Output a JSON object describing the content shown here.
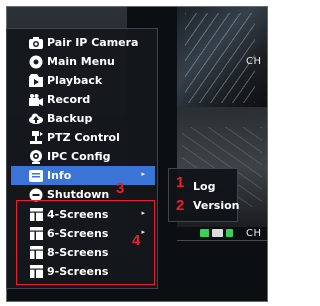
{
  "camera_labels": {
    "top": "CH",
    "bottom": "CH"
  },
  "menu": {
    "items": [
      {
        "label": "Pair IP Camera",
        "icon": "camera-icon"
      },
      {
        "label": "Main Menu",
        "icon": "gear-icon"
      },
      {
        "label": "Playback",
        "icon": "playback-icon"
      },
      {
        "label": "Record",
        "icon": "record-icon"
      },
      {
        "label": "Backup",
        "icon": "cloud-backup-icon"
      },
      {
        "label": "PTZ Control",
        "icon": "ptz-icon"
      },
      {
        "label": "IPC Config",
        "icon": "ipc-config-icon"
      },
      {
        "label": "Info",
        "icon": "info-icon",
        "selected": true,
        "has_submenu": true
      },
      {
        "label": "Shutdown",
        "icon": "power-icon"
      },
      {
        "label": "4-Screens",
        "icon": "screen-layout-icon",
        "has_submenu": true
      },
      {
        "label": "6-Screens",
        "icon": "screen-layout-icon",
        "has_submenu": true
      },
      {
        "label": "8-Screens",
        "icon": "screen-layout-icon"
      },
      {
        "label": "9-Screens",
        "icon": "screen-layout-icon"
      }
    ],
    "submenu_arrow": "▸"
  },
  "submenu": {
    "items": [
      "Log",
      "Version"
    ]
  },
  "annotations": {
    "one": "1",
    "two": "2",
    "three": "3",
    "four": "4",
    "color": "#e8212b"
  },
  "colors": {
    "selected": "#3b73d6",
    "status_green": "#39d353"
  }
}
